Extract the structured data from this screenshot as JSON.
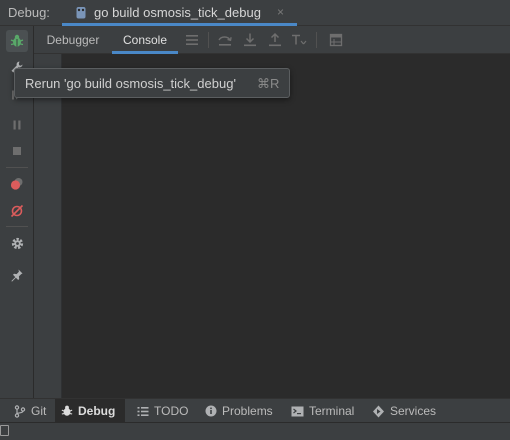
{
  "titlebar": {
    "label": "Debug:",
    "tab": {
      "title": "go build osmosis_tick_debug",
      "close": "×",
      "icon": "gopher-file-icon"
    }
  },
  "toolbar": {
    "tabs": [
      {
        "label": "Debugger",
        "selected": false
      },
      {
        "label": "Console",
        "selected": true
      }
    ],
    "tools": [
      "hamburger-menu-icon",
      "step-over-icon",
      "step-into-icon",
      "step-out-icon",
      "run-to-cursor-icon",
      "evaluate-icon"
    ]
  },
  "left_strip": {
    "buttons": [
      "debug-rerun-icon",
      "wrench-icon",
      "resume-icon",
      "pause-icon",
      "stop-icon",
      "view-breakpoints-icon",
      "mute-breakpoints-icon",
      "settings-icon",
      "pin-icon"
    ]
  },
  "tooltip": {
    "text": "Rerun 'go build osmosis_tick_debug'",
    "shortcut": "⌘R"
  },
  "statusbar": {
    "items": [
      {
        "label": "Git",
        "icon": "git-branch-icon",
        "active": false
      },
      {
        "label": "Debug",
        "icon": "bug-icon",
        "active": true
      },
      {
        "label": "TODO",
        "icon": "list-icon",
        "active": false
      },
      {
        "label": "Problems",
        "icon": "info-circle-icon",
        "active": false
      },
      {
        "label": "Terminal",
        "icon": "terminal-icon",
        "active": false
      },
      {
        "label": "Services",
        "icon": "services-icon",
        "active": false
      }
    ]
  },
  "colors": {
    "accent": "#4a88c7",
    "panel": "#3c3f41",
    "editor": "#2b2b2b",
    "debug_green": "#59a869",
    "breakpoint_red": "#db5c5c"
  }
}
